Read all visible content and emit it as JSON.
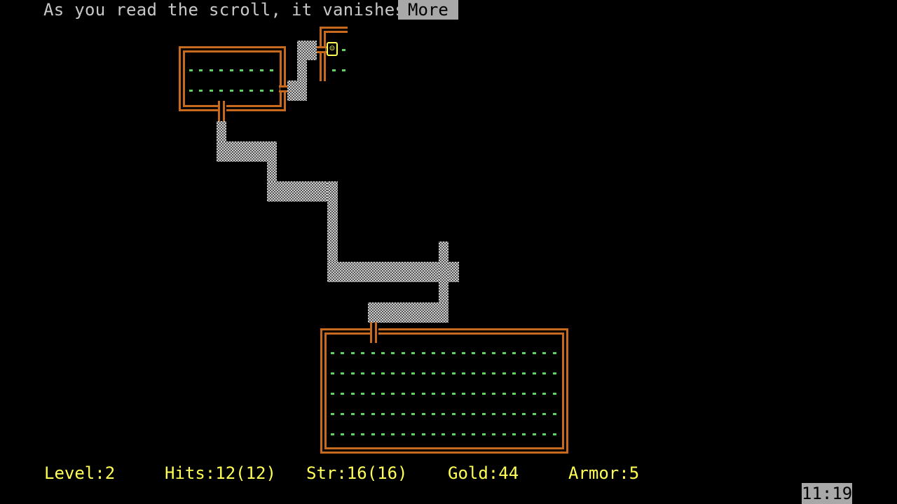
{
  "message": {
    "text": "As you read the scroll, it vanishes",
    "more_label": "More"
  },
  "status": {
    "level": "Level:2",
    "hits": "Hits:12(12)",
    "str": "Str:16(16)",
    "gold": "Gold:44",
    "armor": "Armor:5"
  },
  "clock": "11:19",
  "map": {
    "player_glyph": "☺",
    "colors": {
      "wall": "#c86a1e",
      "floor": "#5fd35f",
      "text": "#c8c8c8",
      "status": "#ffff55",
      "highlight_bg": "#a8a8a8"
    },
    "rooms": [
      {
        "name": "room-top-left",
        "floor_rows": 2,
        "floor_cols": 9
      },
      {
        "name": "room-top-right",
        "floor_rows": 2,
        "floor_cols": 2,
        "partial": true
      },
      {
        "name": "room-bottom",
        "floor_rows": 5,
        "floor_cols": 23
      }
    ]
  }
}
